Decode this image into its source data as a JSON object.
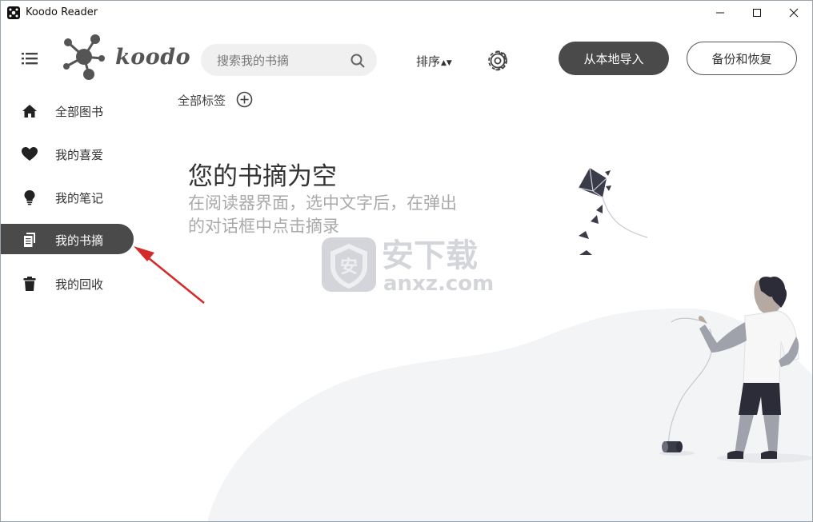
{
  "window": {
    "title": "Koodo Reader",
    "minimize_icon": "minimize-icon",
    "maximize_icon": "maximize-icon",
    "close_icon": "close-icon"
  },
  "header": {
    "logo_text": "koodo",
    "search_placeholder": "搜索我的书摘",
    "sort_label": "排序",
    "sort_arrows": "▲▼",
    "import_button": "从本地导入",
    "backup_button": "备份和恢复"
  },
  "sidebar": {
    "items": [
      {
        "label": "全部图书",
        "icon": "home-icon"
      },
      {
        "label": "我的喜爱",
        "icon": "heart-icon"
      },
      {
        "label": "我的笔记",
        "icon": "lightbulb-icon"
      },
      {
        "label": "我的书摘",
        "icon": "copy-icon",
        "active": true
      },
      {
        "label": "我的回收",
        "icon": "trash-icon"
      }
    ]
  },
  "tags": {
    "all_label": "全部标签"
  },
  "empty": {
    "title": "您的书摘为空",
    "line1": "在阅读器界面，选中文字后，在弹出",
    "line2": "的对话框中点击摘录"
  },
  "watermark": {
    "line1": "安下载",
    "line2": "anxz.com"
  },
  "colors": {
    "dark": "#4a4a4a",
    "annotation_arrow": "#d42a2a",
    "light_text": "#aaaaaa"
  }
}
